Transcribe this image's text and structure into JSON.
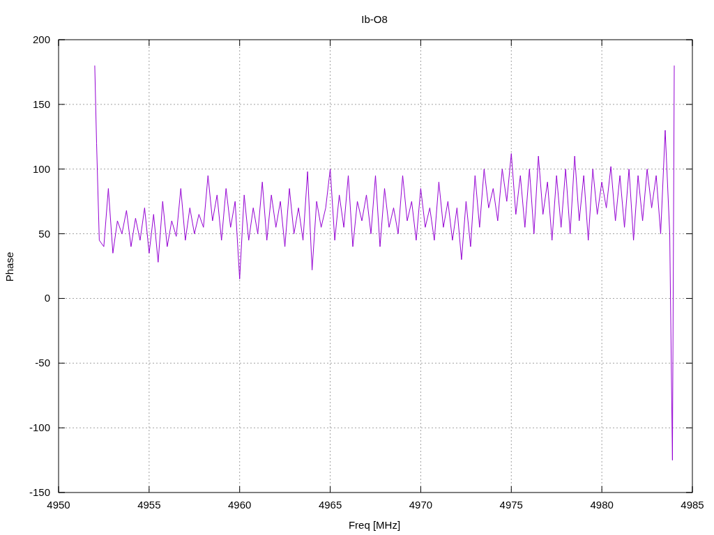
{
  "chart_data": {
    "type": "line",
    "grid": true,
    "title": "Ib-O8",
    "xlabel": "Freq [MHz]",
    "ylabel": "Phase",
    "xlim": [
      4950,
      4985
    ],
    "ylim": [
      -150,
      200
    ],
    "xticks": [
      4950,
      4955,
      4960,
      4965,
      4970,
      4975,
      4980,
      4985
    ],
    "yticks": [
      -150,
      -100,
      -50,
      0,
      50,
      100,
      150,
      200
    ],
    "x": [
      4952,
      4952.1,
      4952.25,
      4952.5,
      4952.75,
      4953,
      4953.25,
      4953.5,
      4953.75,
      4954,
      4954.25,
      4954.5,
      4954.75,
      4955,
      4955.25,
      4955.5,
      4955.75,
      4956,
      4956.25,
      4956.5,
      4956.75,
      4957,
      4957.25,
      4957.5,
      4957.75,
      4958,
      4958.25,
      4958.5,
      4958.75,
      4959,
      4959.25,
      4959.5,
      4959.75,
      4960,
      4960.25,
      4960.5,
      4960.75,
      4961,
      4961.25,
      4961.5,
      4961.75,
      4962,
      4962.25,
      4962.5,
      4962.75,
      4963,
      4963.25,
      4963.5,
      4963.75,
      4964,
      4964.25,
      4964.5,
      4964.75,
      4965,
      4965.25,
      4965.5,
      4965.75,
      4966,
      4966.25,
      4966.5,
      4966.75,
      4967,
      4967.25,
      4967.5,
      4967.75,
      4968,
      4968.25,
      4968.5,
      4968.75,
      4969,
      4969.25,
      4969.5,
      4969.75,
      4970,
      4970.25,
      4970.5,
      4970.75,
      4971,
      4971.25,
      4971.5,
      4971.75,
      4972,
      4972.25,
      4972.5,
      4972.75,
      4973,
      4973.25,
      4973.5,
      4973.75,
      4974,
      4974.25,
      4974.5,
      4974.75,
      4975,
      4975.25,
      4975.5,
      4975.75,
      4976,
      4976.25,
      4976.5,
      4976.75,
      4977,
      4977.25,
      4977.5,
      4977.75,
      4978,
      4978.25,
      4978.5,
      4978.75,
      4979,
      4979.25,
      4979.5,
      4979.75,
      4980,
      4980.25,
      4980.5,
      4980.75,
      4981,
      4981.25,
      4981.5,
      4981.75,
      4982,
      4982.25,
      4982.5,
      4982.75,
      4983,
      4983.25,
      4983.5,
      4983.75,
      4983.9,
      4984
    ],
    "series": [
      {
        "color": "#9400d3",
        "values": [
          180,
          120,
          45,
          40,
          85,
          35,
          60,
          50,
          68,
          40,
          62,
          45,
          70,
          35,
          65,
          28,
          75,
          40,
          60,
          48,
          85,
          45,
          70,
          50,
          65,
          55,
          95,
          60,
          80,
          45,
          85,
          55,
          75,
          15,
          80,
          45,
          70,
          50,
          90,
          45,
          80,
          55,
          75,
          40,
          85,
          50,
          70,
          45,
          98,
          22,
          75,
          55,
          70,
          100,
          45,
          80,
          55,
          95,
          40,
          75,
          60,
          80,
          50,
          95,
          40,
          85,
          55,
          70,
          50,
          95,
          60,
          75,
          45,
          85,
          55,
          70,
          45,
          90,
          55,
          75,
          45,
          70,
          30,
          75,
          40,
          95,
          55,
          100,
          70,
          85,
          60,
          100,
          75,
          112,
          65,
          95,
          55,
          100,
          50,
          110,
          65,
          90,
          45,
          95,
          55,
          100,
          50,
          110,
          60,
          95,
          45,
          100,
          65,
          90,
          70,
          102,
          60,
          95,
          55,
          100,
          45,
          95,
          60,
          100,
          70,
          95,
          50,
          130,
          50,
          -125,
          180
        ]
      }
    ]
  }
}
